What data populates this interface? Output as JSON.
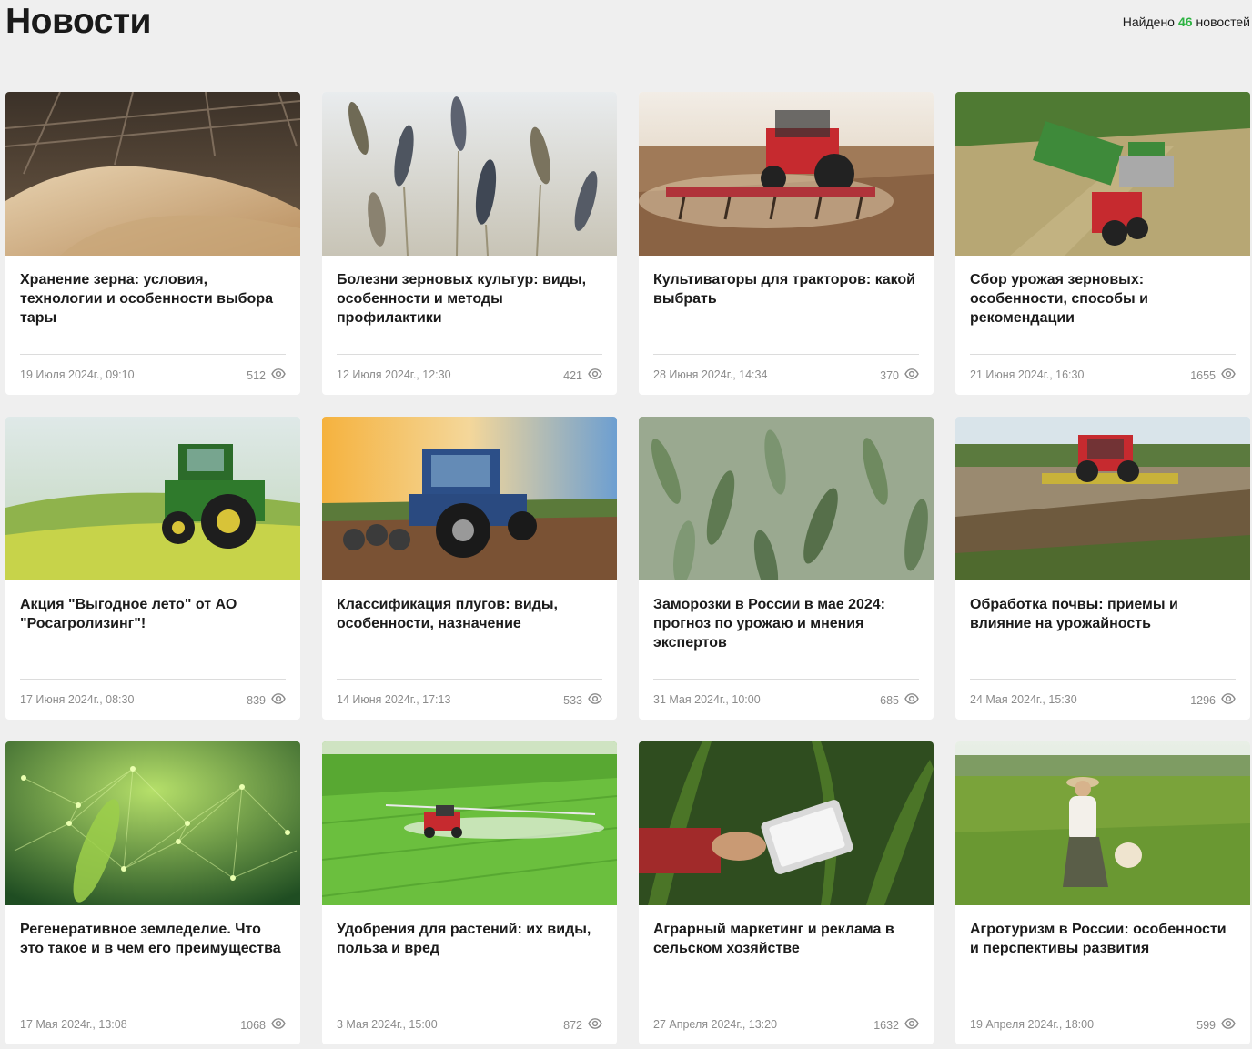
{
  "header": {
    "title": "Новости",
    "found_prefix": "Найдено",
    "found_count": "46",
    "found_suffix": "новостей"
  },
  "cards": [
    {
      "title": "Хранение зерна: условия, технологии и особенности выбора тары",
      "date": "19 Июля 2024г., 09:10",
      "views": "512",
      "image": "grain-warehouse"
    },
    {
      "title": "Болезни зерновых культур: виды, особенности и методы профилактики",
      "date": "12 Июля 2024г., 12:30",
      "views": "421",
      "image": "wheat-ears"
    },
    {
      "title": "Культиваторы для тракторов: какой выбрать",
      "date": "28 Июня 2024г., 14:34",
      "views": "370",
      "image": "red-tractor-cultivator"
    },
    {
      "title": "Сбор урожая зерновых: особенности, способы и рекомендации",
      "date": "21 Июня 2024г., 16:30",
      "views": "1655",
      "image": "harvest-combine"
    },
    {
      "title": "Акция \"Выгодное лето\" от АО \"Росагролизинг\"!",
      "date": "17 Июня 2024г., 08:30",
      "views": "839",
      "image": "green-tractor"
    },
    {
      "title": "Классификация плугов: виды, особенности, назначение",
      "date": "14 Июня 2024г., 17:13",
      "views": "533",
      "image": "blue-tractor-sunset"
    },
    {
      "title": "Заморозки в России в мае 2024: прогноз по урожаю и мнения экспертов",
      "date": "31 Мая 2024г., 10:00",
      "views": "685",
      "image": "green-wheat"
    },
    {
      "title": "Обработка почвы: приемы и влияние на урожайность",
      "date": "24 Мая 2024г., 15:30",
      "views": "1296",
      "image": "tractor-field"
    },
    {
      "title": "Регенеративное земледелие. Что это такое и в чем его преимущества",
      "date": "17 Мая 2024г., 13:08",
      "views": "1068",
      "image": "digital-plant"
    },
    {
      "title": "Удобрения для растений: их виды, польза и вред",
      "date": "3 Мая 2024г., 15:00",
      "views": "872",
      "image": "sprayer-field"
    },
    {
      "title": "Аграрный маркетинг и реклама в сельском хозяйстве",
      "date": "27 Апреля 2024г., 13:20",
      "views": "1632",
      "image": "tablet-in-field"
    },
    {
      "title": "Агротуризм в России: особенности и перспективы развития",
      "date": "19 Апреля 2024г., 18:00",
      "views": "599",
      "image": "woman-in-field"
    }
  ]
}
